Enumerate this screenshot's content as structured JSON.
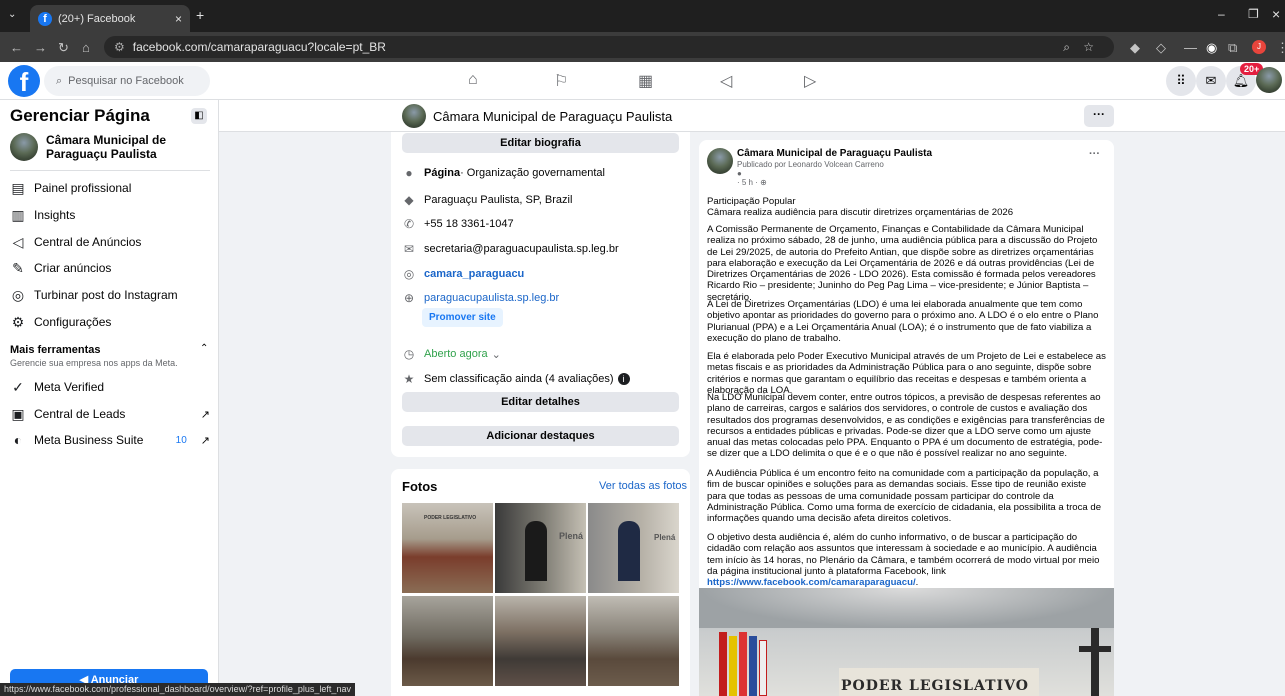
{
  "browser": {
    "tab_title": "(20+) Facebook",
    "url": "facebook.com/camaraparaguacu?locale=pt_BR",
    "status_url": "https://www.facebook.com/professional_dashboard/overview/?ref=profile_plus_left_nav"
  },
  "fb_header": {
    "search_placeholder": "Pesquisar no Facebook",
    "notifications": "20+"
  },
  "sidebar": {
    "title": "Gerenciar Página",
    "page_name": "Câmara Municipal de Paraguaçu Paulista",
    "items": [
      {
        "label": "Painel profissional",
        "icon": "dashboard-icon"
      },
      {
        "label": "Insights",
        "icon": "insights-icon"
      },
      {
        "label": "Central de Anúncios",
        "icon": "megaphone-icon"
      },
      {
        "label": "Criar anúncios",
        "icon": "pencil-icon"
      },
      {
        "label": "Turbinar post do Instagram",
        "icon": "instagram-icon"
      },
      {
        "label": "Configurações",
        "icon": "gear-icon"
      }
    ],
    "more_tools_title": "Mais ferramentas",
    "more_tools_subtitle": "Gerencie sua empresa nos apps da Meta.",
    "tools": [
      {
        "label": "Meta Verified",
        "icon": "verified-icon",
        "badge": ""
      },
      {
        "label": "Central de Leads",
        "icon": "leads-icon",
        "badge": ""
      },
      {
        "label": "Meta Business Suite",
        "icon": "business-suite-icon",
        "badge": "10"
      }
    ],
    "advertise_label": "Anunciar"
  },
  "page_bar": {
    "name": "Câmara Municipal de Paraguaçu Paulista",
    "more": "···"
  },
  "intro": {
    "edit_bio": "Editar biografia",
    "category_label": "Página",
    "category_value": " · Organização governamental",
    "location": "Paraguaçu Paulista, SP, Brazil",
    "phone": "+55 18 3361-1047",
    "email": "secretaria@paraguacupaulista.sp.leg.br",
    "instagram": "camara_paraguacu",
    "website": "paraguacupaulista.sp.leg.br",
    "promote_site": "Promover site",
    "hours": "Aberto agora",
    "rating": "Sem classificação ainda (4 avaliações)",
    "edit_details": "Editar detalhes",
    "add_highlights": "Adicionar destaques"
  },
  "photos": {
    "title": "Fotos",
    "see_all": "Ver todas as fotos",
    "banner_text": "PODER LEGISLATIVO",
    "plenario": "Plená"
  },
  "post": {
    "author": "Câmara Municipal de Paraguaçu Paulista",
    "published_by_prefix": "Publicado por ",
    "published_by": "Leonardo Volcean Carreno",
    "time": "· 5 h ·",
    "more": "···",
    "headline1": "Participação Popular",
    "headline2": "Câmara realiza audiência para discutir diretrizes orçamentárias de 2026",
    "p1": "A Comissão Permanente de Orçamento, Finanças e Contabilidade da Câmara Municipal realiza no próximo sábado, 28 de junho, uma audiência pública para a discussão do Projeto de Lei 29/2025, de autoria do Prefeito Antian, que dispõe sobre as diretrizes orçamentárias para elaboração e execução da Lei Orçamentária de 2026 e dá outras providências (Lei de Diretrizes Orçamentárias de 2026 - LDO 2026). Esta comissão é formada pelos vereadores Ricardo Rio – presidente; Juninho do Peg Pag Lima – vice-presidente; e Júnior Baptista – secretário.",
    "p2": "A Lei de Diretrizes Orçamentárias (LDO) é uma lei elaborada anualmente que tem como objetivo apontar as prioridades do governo para o próximo ano. A LDO é o elo entre o Plano Plurianual (PPA) e a Lei Orçamentária Anual (LOA); é o instrumento que de fato viabiliza a execução do plano de trabalho.",
    "p3": "Ela é elaborada pelo Poder Executivo Municipal através de um Projeto de Lei e estabelece as metas fiscais e as prioridades da Administração Pública para o ano seguinte, dispõe sobre critérios e normas que garantam o equilíbrio das receitas e despesas e também orienta a elaboração da LOA.",
    "p4": "Na LDO Municipal devem conter, entre outros tópicos, a previsão de despesas referentes ao plano de carreiras, cargos e salários dos servidores, o controle de custos e avaliação dos resultados dos programas desenvolvidos, e as condições e exigências para transferências de recursos a entidades públicas e privadas. Pode-se dizer que a LDO serve como um ajuste anual das metas colocadas pelo PPA. Enquanto o PPA é um documento de estratégia, pode-se dizer que a LDO delimita o que é e o que não é possível realizar no ano seguinte.",
    "p5": "A Audiência Pública é um encontro feito na comunidade com a participação da população, a fim de buscar opiniões e soluções para as demandas sociais. Esse tipo de reunião existe para que todas as pessoas de uma comunidade possam participar do controle da Administração Pública. Como uma forma de exercício de cidadania, ela possibilita a troca de informações quando uma decisão afeta direitos coletivos.",
    "p6": "O objetivo desta audiência é, além do cunho informativo, o de buscar a participação do cidadão com relação aos assuntos que interessam à sociedade e ao município. A audiência tem início às 14 horas, no Plenário da Câmara, e também ocorrerá de modo virtual por meio da página institucional junto à plataforma Facebook, link ",
    "p6_link": "https://www.facebook.com/camaraparaguacu/",
    "p6_end": ".",
    "image_text": "PODER LEGISLATIVO"
  }
}
